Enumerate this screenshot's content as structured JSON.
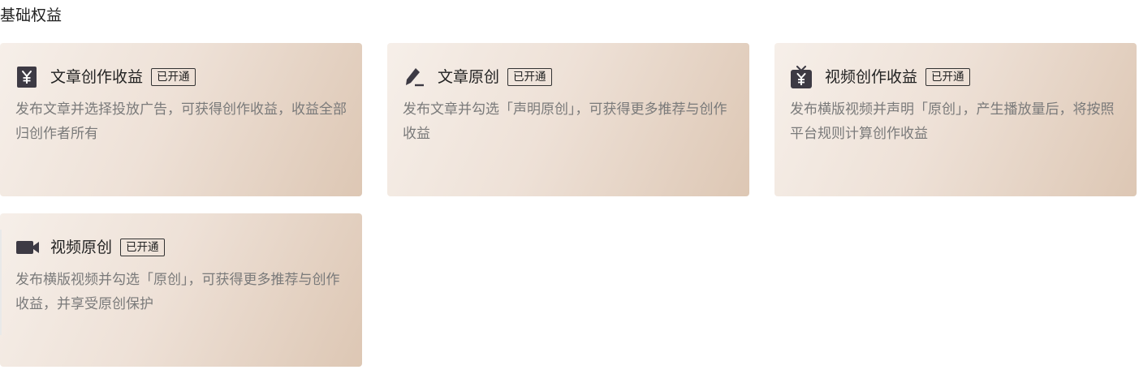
{
  "section": {
    "title": "基础权益"
  },
  "cards": [
    {
      "icon": "yuan-icon",
      "title": "文章创作收益",
      "badge": "已开通",
      "desc": "发布文章并选择投放广告，可获得创作收益，收益全部归创作者所有"
    },
    {
      "icon": "pen-icon",
      "title": "文章原创",
      "badge": "已开通",
      "desc": "发布文章并勾选「声明原创」，可获得更多推荐与创作收益"
    },
    {
      "icon": "tv-yuan-icon",
      "title": "视频创作收益",
      "badge": "已开通",
      "desc": "发布横版视频并声明「原创」，产生播放量后，将按照平台规则计算创作收益"
    },
    {
      "icon": "video-camera-icon",
      "title": "视频原创",
      "badge": "已开通",
      "desc": "发布横版视频并勾选「原创」，可获得更多推荐与创作收益，并享受原创保护"
    }
  ],
  "colors": {
    "icon": "#3d3a44",
    "desc_text": "#7a7a7a",
    "card_gradient_start": "#f6efe9",
    "card_gradient_end": "#ddc7b4"
  }
}
